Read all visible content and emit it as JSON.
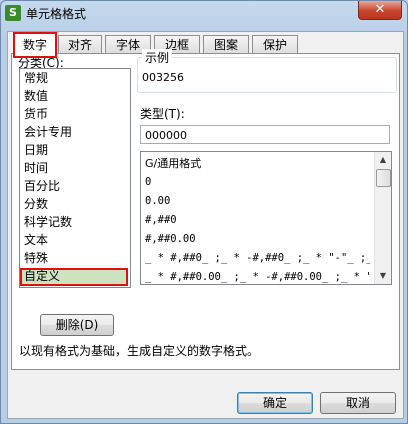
{
  "window": {
    "title": "单元格格式",
    "app_icon": "S",
    "close": "✕"
  },
  "tabs": [
    {
      "label": "数字",
      "active": true
    },
    {
      "label": "对齐"
    },
    {
      "label": "字体"
    },
    {
      "label": "边框"
    },
    {
      "label": "图案"
    },
    {
      "label": "保护"
    }
  ],
  "category": {
    "label": "分类(C):",
    "items": [
      "常规",
      "数值",
      "货币",
      "会计专用",
      "日期",
      "时间",
      "百分比",
      "分数",
      "科学记数",
      "文本",
      "特殊",
      "自定义"
    ],
    "selected": "自定义"
  },
  "sample": {
    "label": "示例",
    "value": "003256"
  },
  "type": {
    "label": "类型(T):",
    "value": "000000",
    "formats": [
      "G/通用格式",
      "0",
      "0.00",
      "#,##0",
      "#,##0.00",
      "_ * #,##0_ ;_ * -#,##0_ ;_ * \"-\"_ ;_ @_",
      "_ * #,##0.00_ ;_ * -#,##0.00_ ;_ * \"-\"??_ ;_ @_"
    ]
  },
  "delete_button": "删除(D)",
  "description": "以现有格式为基础，生成自定义的数字格式。",
  "buttons": {
    "ok": "确定",
    "cancel": "取消"
  },
  "colors": {
    "highlight": "#e01010",
    "selected_bg": "#cde3c0"
  }
}
